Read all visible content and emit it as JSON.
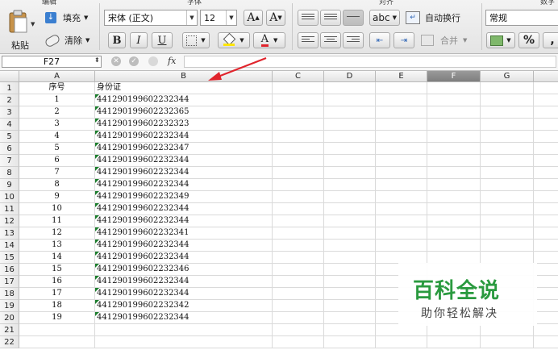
{
  "ribbon": {
    "groups": {
      "edit": "编辑",
      "font": "字体",
      "align": "对齐",
      "number": "数字"
    },
    "paste_label": "粘贴",
    "fill_label": "填充",
    "clear_label": "清除",
    "font_name": "宋体 (正文)",
    "font_size": "12",
    "grow_font": "A",
    "shrink_font": "A",
    "bold": "B",
    "italic": "I",
    "underline": "U",
    "font_color": "A",
    "text_direction": "abc",
    "wrap_text": "自动换行",
    "merge": "合并",
    "number_format": "常规",
    "percent": "%",
    "comma": ","
  },
  "formula_bar": {
    "cell_ref": "F27",
    "fx": "fx",
    "formula": ""
  },
  "columns": [
    "A",
    "B",
    "C",
    "D",
    "E",
    "F",
    "G"
  ],
  "selected_column": "F",
  "rows": [
    {
      "n": "1",
      "a": "序号",
      "b": "身份证"
    },
    {
      "n": "2",
      "a": "1",
      "b": "441290199602232344"
    },
    {
      "n": "3",
      "a": "2",
      "b": "441290199602232365"
    },
    {
      "n": "4",
      "a": "3",
      "b": "441290199602232323"
    },
    {
      "n": "5",
      "a": "4",
      "b": "441290199602232344"
    },
    {
      "n": "6",
      "a": "5",
      "b": "441290199602232347"
    },
    {
      "n": "7",
      "a": "6",
      "b": "441290199602232344"
    },
    {
      "n": "8",
      "a": "7",
      "b": "441290199602232344"
    },
    {
      "n": "9",
      "a": "8",
      "b": "441290199602232344"
    },
    {
      "n": "10",
      "a": "9",
      "b": "441290199602232349"
    },
    {
      "n": "11",
      "a": "10",
      "b": "441290199602232344"
    },
    {
      "n": "12",
      "a": "11",
      "b": "441290199602232344"
    },
    {
      "n": "13",
      "a": "12",
      "b": "441290199602232341"
    },
    {
      "n": "14",
      "a": "13",
      "b": "441290199602232344"
    },
    {
      "n": "15",
      "a": "14",
      "b": "441290199602232344"
    },
    {
      "n": "16",
      "a": "15",
      "b": "441290199602232346"
    },
    {
      "n": "17",
      "a": "16",
      "b": "441290199602232344"
    },
    {
      "n": "18",
      "a": "17",
      "b": "441290199602232344"
    },
    {
      "n": "19",
      "a": "18",
      "b": "441290199602232342"
    },
    {
      "n": "20",
      "a": "19",
      "b": "441290199602232344"
    },
    {
      "n": "21",
      "a": "",
      "b": ""
    },
    {
      "n": "22",
      "a": "",
      "b": ""
    }
  ],
  "watermark": {
    "title": "百科全说",
    "subtitle": "助你轻松解决"
  },
  "colors": {
    "arrow": "#e0242c",
    "brand_green": "#2a9a3f",
    "text_marker": "#1b7d2c"
  }
}
